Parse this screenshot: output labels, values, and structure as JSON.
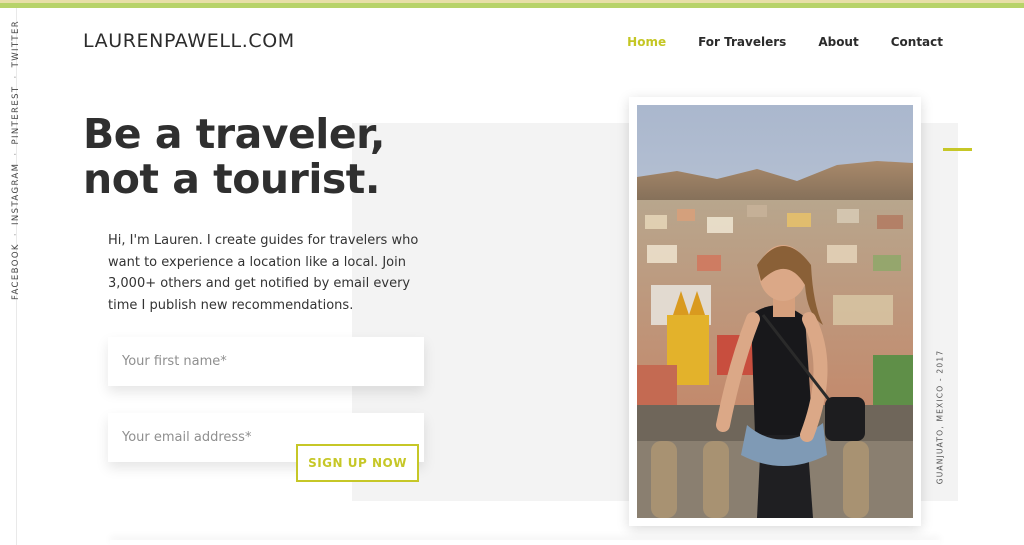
{
  "site": {
    "logo": "LAURENPAWELL.COM"
  },
  "social": {
    "items": [
      "FACEBOOK",
      "INSTAGRAM",
      "PINTEREST",
      "TWITTER"
    ],
    "separator": "·"
  },
  "nav": {
    "items": [
      {
        "label": "Home",
        "active": true
      },
      {
        "label": "For Travelers",
        "active": false
      },
      {
        "label": "About",
        "active": false
      },
      {
        "label": "Contact",
        "active": false
      }
    ]
  },
  "hero": {
    "headline_line1": "Be a traveler,",
    "headline_line2": "not a tourist.",
    "intro": "Hi, I'm Lauren. I create guides for travelers who want to experience a location like a local. Join 3,000+ others and get notified by email every time I publish new recommendations."
  },
  "form": {
    "first_name_placeholder": "Your first name*",
    "email_placeholder": "Your email address*",
    "submit_label": "SIGN UP NOW"
  },
  "photo": {
    "caption": "GUANJUATO, MEXICO - 2017"
  },
  "colors": {
    "accent": "#c6c727",
    "text": "#2f2f2f",
    "panel": "#f3f3f3",
    "stripe_green": "#b7d36a"
  }
}
